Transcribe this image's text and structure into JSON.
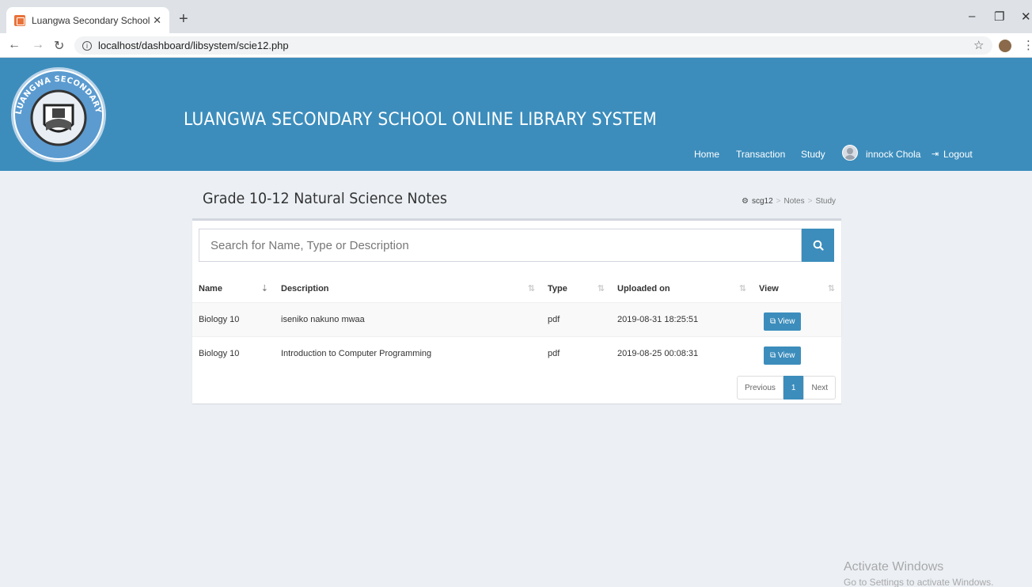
{
  "browser": {
    "tab_title": "Luangwa Secondary School Onlin",
    "tab_close": "✕",
    "new_tab": "+",
    "url": "localhost/dashboard/libsystem/scie12.php",
    "window_controls": [
      "–",
      "❐",
      "✕"
    ]
  },
  "header": {
    "logo_text_top": "LUANGWA SECONDARY SCHOOL",
    "site_title": "LUANGWA SECONDARY SCHOOL ONLINE LIBRARY SYSTEM",
    "nav": {
      "home": "Home",
      "transaction": "Transaction",
      "study": "Study",
      "user": "innock Chola",
      "logout": "Logout"
    },
    "bg_color": "#3c8dbc"
  },
  "page": {
    "title": "Grade 10-12 Natural Science Notes",
    "breadcrumb": [
      "scg12",
      "Notes",
      "Study"
    ]
  },
  "search": {
    "placeholder": "Search for Name, Type or Description"
  },
  "table": {
    "columns": [
      "Name",
      "Description",
      "Type",
      "Uploaded on",
      "View"
    ],
    "rows": [
      {
        "name": "Biology 10",
        "description": "iseniko nakuno mwaa",
        "type": "pdf",
        "uploaded": "2019-08-31 18:25:51",
        "view": "View"
      },
      {
        "name": "Biology 10",
        "description": "Introduction to Computer Programming",
        "type": "pdf",
        "uploaded": "2019-08-25 00:08:31",
        "view": "View"
      }
    ]
  },
  "pagination": {
    "previous": "Previous",
    "current": "1",
    "next": "Next"
  },
  "watermark": {
    "line1": "Activate Windows",
    "line2": "Go to Settings to activate Windows."
  }
}
